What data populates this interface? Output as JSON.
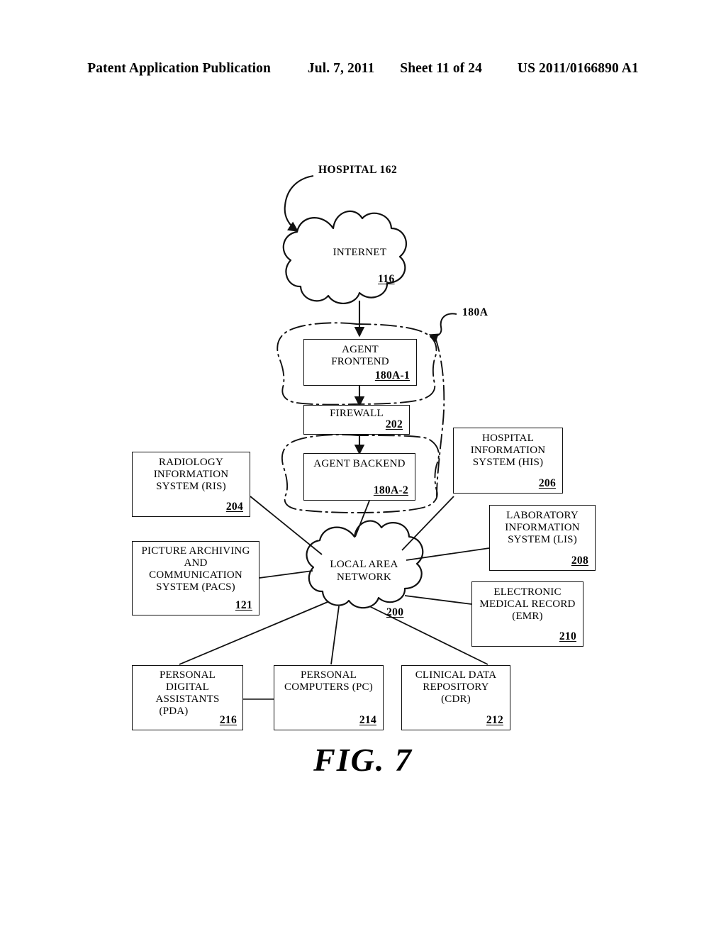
{
  "header": {
    "publication": "Patent Application Publication",
    "date": "Jul. 7, 2011",
    "sheet": "Sheet 11 of 24",
    "patent_number": "US 2011/0166890 A1"
  },
  "figure": {
    "caption": "FIG. 7",
    "callouts": [
      {
        "id": "hospital",
        "label": "HOSPITAL  162"
      },
      {
        "id": "agent-system",
        "label": "180A"
      }
    ],
    "clouds": [
      {
        "id": "internet",
        "label": "INTERNET",
        "ref": "116"
      },
      {
        "id": "lan",
        "label_line1": "LOCAL AREA",
        "label_line2": "NETWORK",
        "ref": "200"
      }
    ],
    "nodes": [
      {
        "id": "agent-frontend",
        "lines": [
          "AGENT",
          "FRONTEND"
        ],
        "ref": "180A-1"
      },
      {
        "id": "firewall",
        "lines": [
          "FIREWALL"
        ],
        "ref": "202"
      },
      {
        "id": "agent-backend",
        "lines": [
          "AGENT BACKEND"
        ],
        "ref": "180A-2"
      },
      {
        "id": "ris",
        "lines": [
          "RADIOLOGY",
          "INFORMATION",
          "SYSTEM (RIS)"
        ],
        "ref": "204"
      },
      {
        "id": "pacs",
        "lines": [
          "PICTURE ARCHIVING",
          "AND",
          "COMMUNICATION",
          "SYSTEM (PACS)"
        ],
        "ref": "121"
      },
      {
        "id": "his",
        "lines": [
          "HOSPITAL",
          "INFORMATION",
          "SYSTEM (HIS)"
        ],
        "ref": "206"
      },
      {
        "id": "lis",
        "lines": [
          "LABORATORY",
          "INFORMATION",
          "SYSTEM (LIS)"
        ],
        "ref": "208"
      },
      {
        "id": "emr",
        "lines": [
          "ELECTRONIC",
          "MEDICAL RECORD",
          "(EMR)"
        ],
        "ref": "210"
      },
      {
        "id": "pda",
        "lines": [
          "PERSONAL",
          "DIGITAL",
          "ASSISTANTS",
          "(PDA)"
        ],
        "ref": "216"
      },
      {
        "id": "pc",
        "lines": [
          "PERSONAL",
          "COMPUTERS (PC)"
        ],
        "ref": "214"
      },
      {
        "id": "cdr",
        "lines": [
          "CLINICAL DATA",
          "REPOSITORY",
          "(CDR)"
        ],
        "ref": "212"
      }
    ]
  },
  "colors": {
    "ink": "#111111",
    "paper": "#ffffff"
  }
}
